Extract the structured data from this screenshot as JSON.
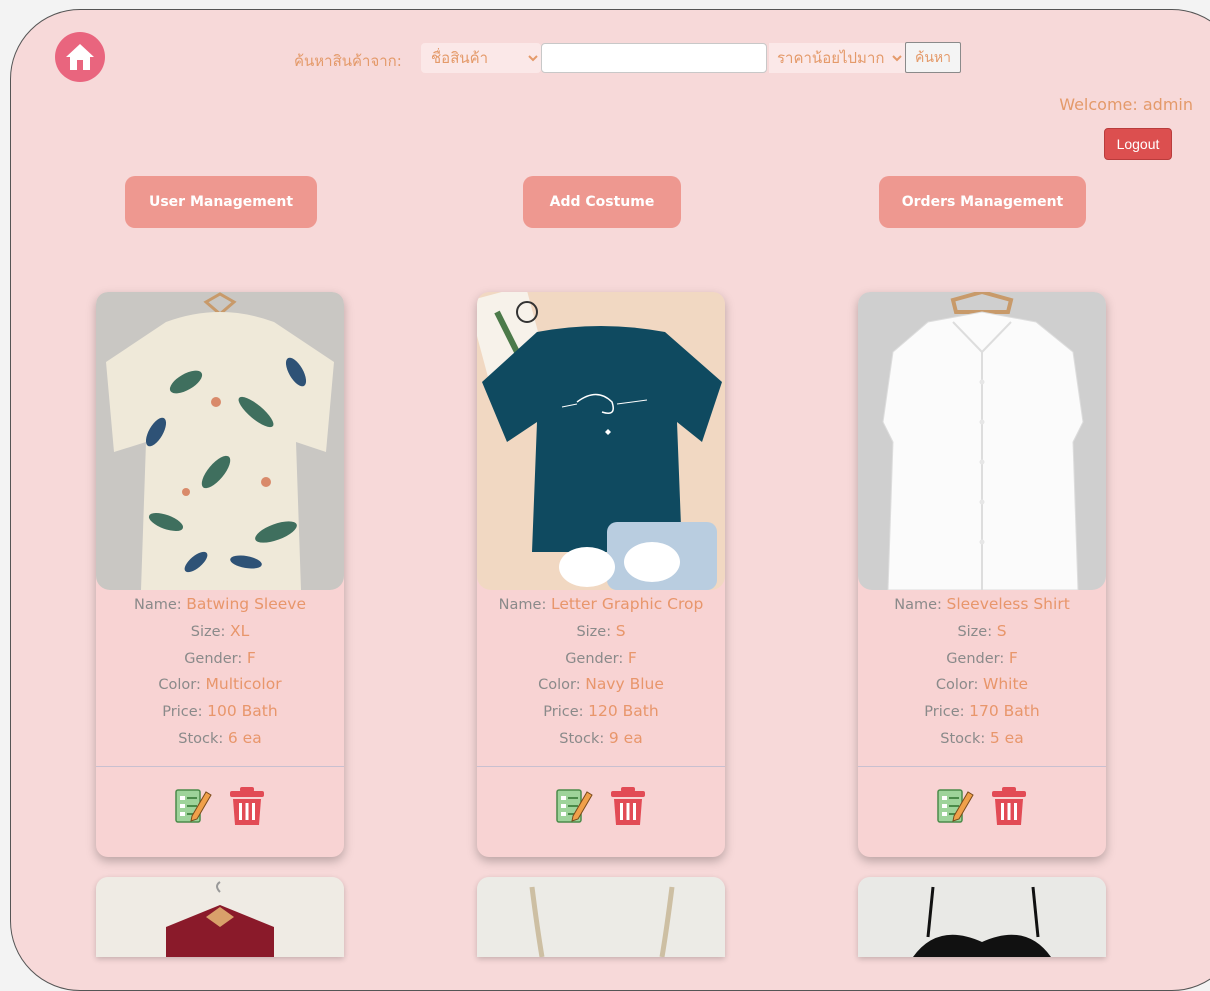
{
  "header": {
    "search_label": "ค้นหาสินค้าจาก:",
    "search_field_selected": "ชื่อสินค้า",
    "search_input_value": "",
    "sort_selected": "ราคาน้อยไปมาก",
    "search_button": "ค้นหา",
    "welcome": "Welcome: admin",
    "logout": "Logout"
  },
  "nav": {
    "user_management": "User Management",
    "add_costume": "Add Costume",
    "orders_management": "Orders Management"
  },
  "labels": {
    "name": "Name:",
    "size": "Size:",
    "gender": "Gender:",
    "color": "Color:",
    "price": "Price:",
    "stock": "Stock:"
  },
  "products": [
    {
      "name": "Batwing Sleeve",
      "size": "XL",
      "gender": "F",
      "color": "Multicolor",
      "price": "100 Bath",
      "stock": "6 ea"
    },
    {
      "name": "Letter Graphic Crop",
      "size": "S",
      "gender": "F",
      "color": "Navy Blue",
      "price": "120 Bath",
      "stock": "9 ea"
    },
    {
      "name": "Sleeveless Shirt",
      "size": "S",
      "gender": "F",
      "color": "White",
      "price": "170 Bath",
      "stock": "5 ea"
    }
  ],
  "colors": {
    "background": "#f7d9d9",
    "accent": "#e8966b",
    "nav_button": "#ee9890",
    "logout": "#dc4f4f",
    "home": "#e9657e"
  }
}
